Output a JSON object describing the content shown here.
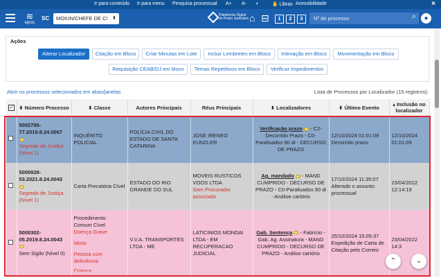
{
  "topbar": {
    "links": [
      "Ir para conteúdo",
      "Ir para menu",
      "Pesquisa processual",
      "A+",
      "A-",
      "◐",
      "Libras",
      "Acessibilidade"
    ],
    "close": "×"
  },
  "navbar": {
    "logo_text": "eproc",
    "sc": "SC",
    "location_select": "MOIUN/CHEFE DE C/",
    "brand": "Plataforma Digital do Poder Judiciário",
    "shortcuts": [
      "1",
      "2",
      "3"
    ],
    "process_placeholder": "Nº de processo"
  },
  "acoes": {
    "title": "Ações",
    "row1": [
      "Alterar Localizador",
      "Citação em Bloco",
      "Criar Minutas em Lote",
      "Incluir Lembretes em Bloco",
      "Intimação em Bloco",
      "Movimentação em Bloco"
    ],
    "row2": [
      "Requisição CEAB/DJ em bloco",
      "Temas Repetitivos em Bloco",
      "Verificar Impedimentos"
    ]
  },
  "list": {
    "open_link": "Abrir os processos selecionados em abas/janelas",
    "info": "Lista de Processos por Localizador (15 registros):"
  },
  "table": {
    "headers": {
      "numero": "Número Processo",
      "classe": "Classe",
      "autores": "Autores Principais",
      "reus": "Réus Principais",
      "localizadores": "Localizadores",
      "ultimo": "Último Evento",
      "inclusao": "Inclusão no localizador"
    },
    "rows": [
      {
        "numero": "5002795-77.2019.8.24.0067",
        "sigilo": "Segredo de Justiça (Nível 1)",
        "classe": "INQUÉRITO POLICIAL",
        "autor": "POLÍCIA CIVIL DO ESTADO DE SANTA CATARINA",
        "reu": "JOSE IRENEO KUNZLER",
        "reu_note": "",
        "loc_tag": "Verificação prazo",
        "loc_text": "- C2-Decorrido Prazo - C0-Paralisados 90 di - DECURSO DE PRAZO",
        "evento_data": "12/10/2024 01:01:09",
        "evento_desc": "Decorrido prazo",
        "inclusao": "12/10/2024 01:01:09"
      },
      {
        "numero": "5000928-53.2021.8.24.0043",
        "sigilo": "Segredo de Justiça (Nível 1)",
        "classe": "Carta Precatória Cível",
        "autor": "ESTADO DO RIO GRANDE DO SUL",
        "reu": "MOVEIS RUSTICOS VOOS LTDA",
        "reu_note": "Sem Procurador associado",
        "loc_tag": "Ag. mandado",
        "loc_text": "- MAND CUMPRIDO - DECURSO DE PRAZO - C0-Paralisados 90 di - Análise cartório",
        "evento_data": "17/10/2024 11:35:07",
        "evento_desc": "Alterado o assunto processual",
        "inclusao": "23/04/2022 12:14:19"
      },
      {
        "numero": "5000302-05.2019.8.24.0043",
        "sigilo": "Sem Sigilo (Nível 0)",
        "classe": "Procedimento Comum Cível",
        "classe_notes": [
          "Doença Grave",
          "Idoso",
          "Pessoa com deficiência",
          "Criança"
        ],
        "autor": "V.V.A. TRANSPORTES LTDA - ME",
        "reu": "LATICINIOS MONDAI LTDA - EM RECUPERACAO JUDICIAL",
        "reu_note": "",
        "loc_tag": "Gab. Sentença",
        "loc_text": "- Fabrício - Gab. Ag. Assinatura - MAND CUMPRIDO - DECURSO DE PRAZO - Análise cartório",
        "evento_data": "25/10/2024 15:05:37",
        "evento_desc": "Expedição de Carta de Citação pelo Correio",
        "inclusao": "23/04/2022 14:3"
      }
    ]
  },
  "colors": {
    "topbar": "#0f5396",
    "navbar": "#1a5fb0",
    "row1": "#8ca9cc",
    "row2": "#d2d2d2",
    "row3": "#f5c2d8",
    "highlight": "#e0242a"
  }
}
